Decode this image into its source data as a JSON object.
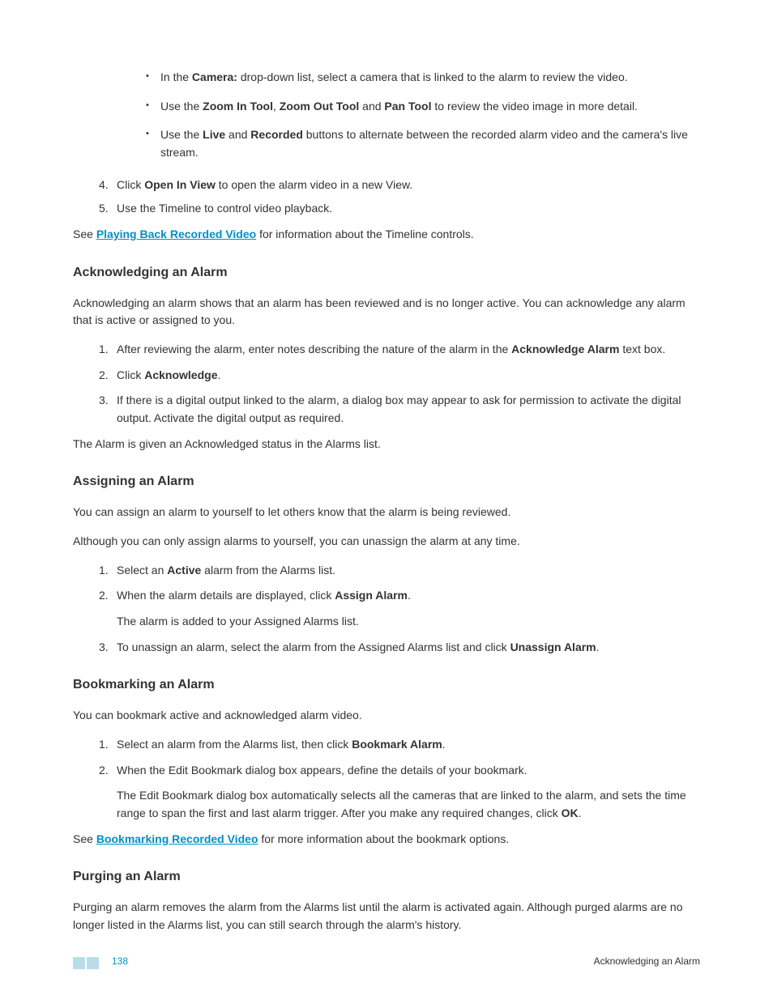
{
  "bullets": [
    {
      "pre": "In the ",
      "b1": "Camera:",
      "post": " drop-down list, select a camera that is linked to the alarm to review the video."
    },
    {
      "pre": "Use the ",
      "b1": "Zoom In Tool",
      "mid1": ", ",
      "b2": "Zoom Out Tool",
      "mid2": " and ",
      "b3": "Pan Tool",
      "post": " to review the video image in more detail."
    },
    {
      "pre": "Use the ",
      "b1": "Live",
      "mid1": " and ",
      "b2": "Recorded",
      "post": " buttons to alternate between the recorded alarm video and the camera's live stream."
    }
  ],
  "step4": {
    "num": "4.",
    "pre": "Click ",
    "b": "Open In View",
    "post": " to open the alarm video in a new View."
  },
  "step5": {
    "num": "5.",
    "text": "Use the Timeline to control video playback."
  },
  "seePlayback": {
    "pre": "See ",
    "link": "Playing Back Recorded Video",
    "post": " for information about the Timeline controls."
  },
  "ack": {
    "heading": "Acknowledging an Alarm",
    "intro": "Acknowledging an alarm shows that an alarm has been reviewed and is no longer active. You can acknowledge any alarm that is active or assigned to you.",
    "steps": [
      {
        "num": "1.",
        "pre": "After reviewing the alarm, enter notes describing the nature of the alarm in the ",
        "b": "Acknowledge Alarm",
        "post": " text box."
      },
      {
        "num": "2.",
        "pre": "Click ",
        "b": "Acknowledge",
        "post": "."
      },
      {
        "num": "3.",
        "text": "If there is a digital output linked to the alarm, a dialog box may appear to ask for permission to activate the digital output. Activate the digital output as required."
      }
    ],
    "outro": "The Alarm is given an Acknowledged status in the Alarms list."
  },
  "assign": {
    "heading": "Assigning an Alarm",
    "intro1": "You can assign an alarm to yourself to let others know that the alarm is being reviewed.",
    "intro2": "Although you can only assign alarms to yourself, you can unassign the alarm at any time.",
    "steps": [
      {
        "num": "1.",
        "pre": "Select an ",
        "b": "Active",
        "post": " alarm from the Alarms list."
      },
      {
        "num": "2.",
        "pre": "When the alarm details are displayed, click ",
        "b": "Assign Alarm",
        "post": ".",
        "sub": "The alarm is added to your Assigned Alarms list."
      },
      {
        "num": "3.",
        "pre": "To unassign an alarm, select the alarm from the Assigned Alarms list and click ",
        "b": "Unassign Alarm",
        "post": "."
      }
    ]
  },
  "bookmark": {
    "heading": "Bookmarking an Alarm",
    "intro": "You can bookmark active and acknowledged alarm video.",
    "steps": [
      {
        "num": "1.",
        "pre": "Select an alarm from the Alarms list, then click ",
        "b": "Bookmark Alarm",
        "post": "."
      },
      {
        "num": "2.",
        "text": "When the Edit Bookmark dialog box appears, define the details of your bookmark.",
        "subPre": "The Edit Bookmark dialog box automatically selects all the cameras that are linked to the alarm, and sets the time range to span the first and last alarm trigger. After you make any required changes, click ",
        "subB": "OK",
        "subPost": "."
      }
    ],
    "seePre": "See ",
    "seeLink": "Bookmarking Recorded Video",
    "seePost": " for more information about the bookmark options."
  },
  "purge": {
    "heading": "Purging an Alarm",
    "intro": "Purging an alarm removes the alarm from the Alarms list until the alarm is activated again. Although purged alarms are no longer listed in the Alarms list, you can still search through the alarm's history."
  },
  "footer": {
    "pageNum": "138",
    "title": "Acknowledging an Alarm"
  }
}
